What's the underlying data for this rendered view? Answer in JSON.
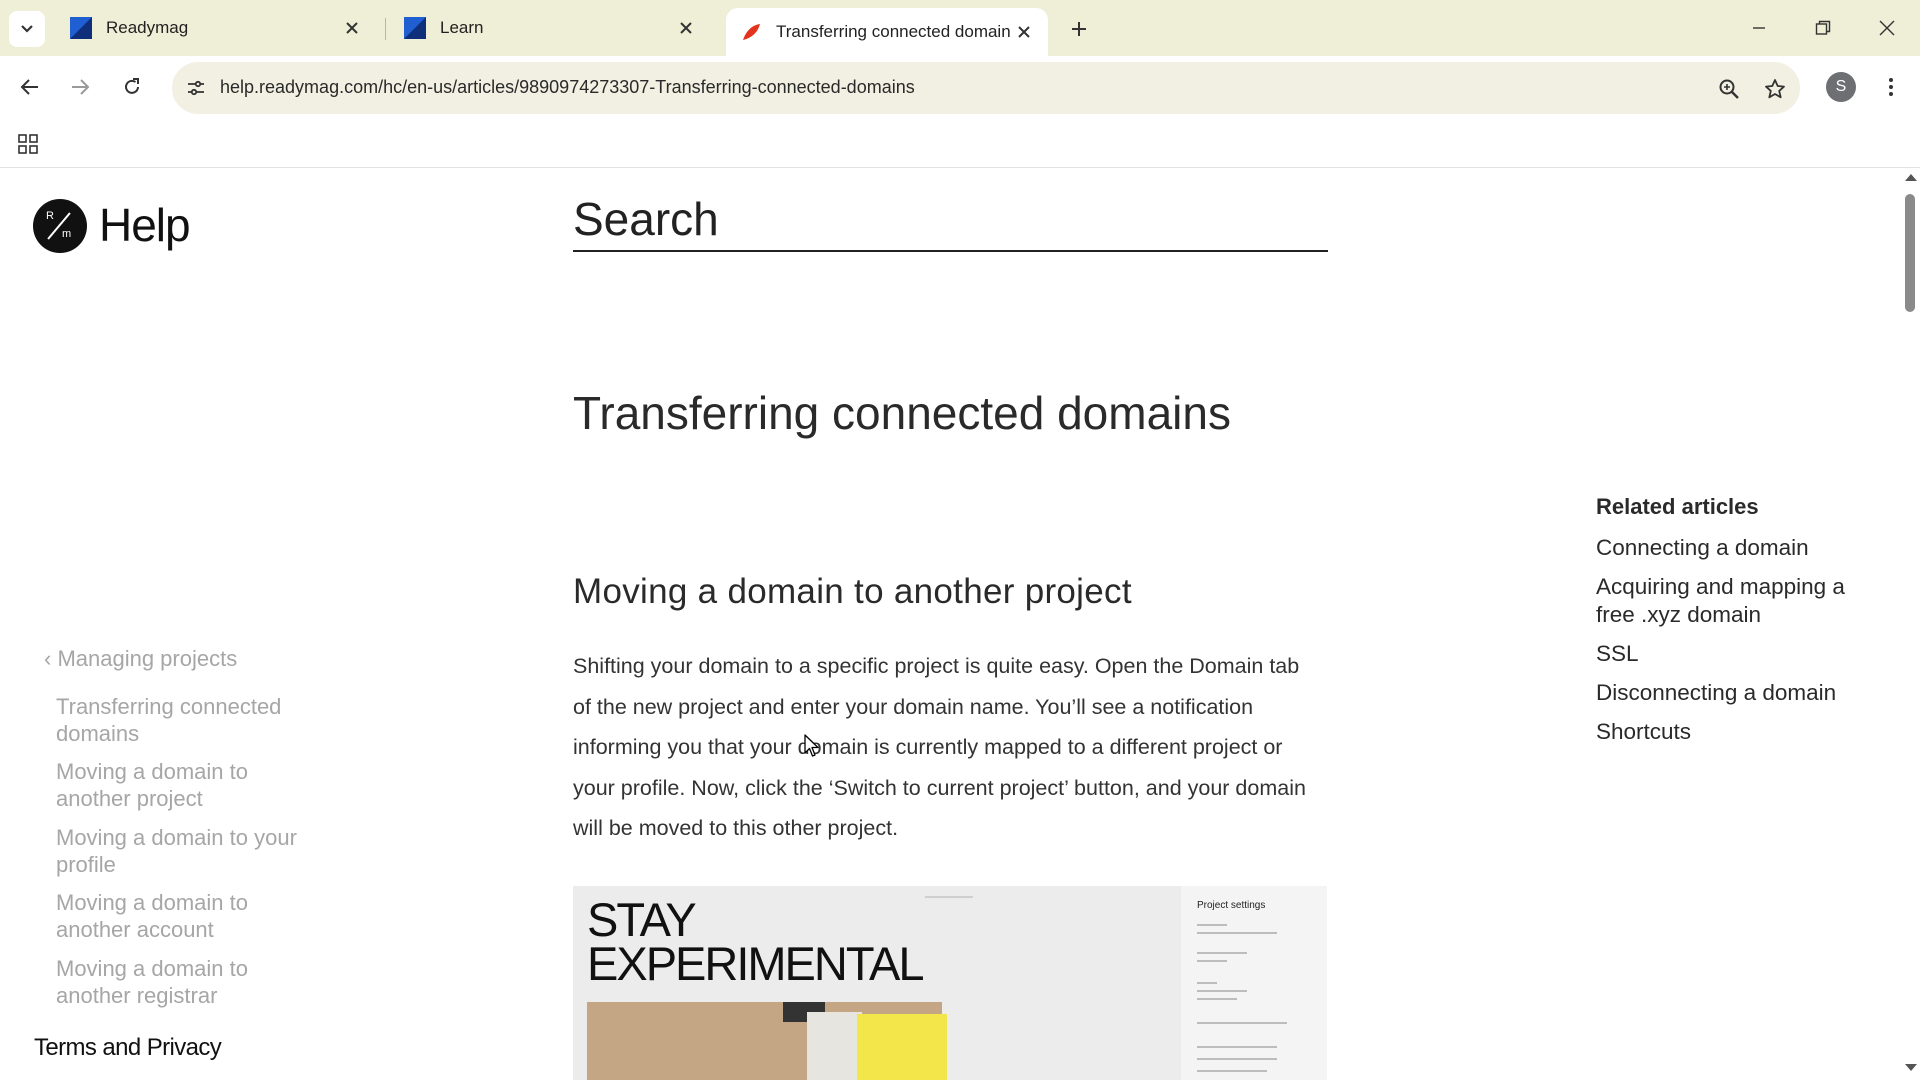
{
  "browser": {
    "tabs": [
      {
        "title": "Readymag",
        "icon": "readymag-favicon",
        "active": false
      },
      {
        "title": "Learn",
        "icon": "readymag-favicon",
        "active": false
      },
      {
        "title": "Transferring connected domain",
        "icon": "help-favicon",
        "active": true
      }
    ],
    "url": "help.readymag.com/hc/en-us/articles/9890974273307-Transferring-connected-domains",
    "profile_initial": "S"
  },
  "header": {
    "logo_r": "R",
    "logo_m": "m",
    "help_title": "Help",
    "search_placeholder": "Search"
  },
  "article": {
    "title": "Transferring connected domains",
    "section_title": "Moving a domain to another project",
    "body": "Shifting your domain to a specific project is quite easy. Open the Domain tab of the new project and enter your domain name. You’ll see a notification informing you that your domain is currently mapped to a different project or your profile. Now, click the ‘Switch to current project’ button, and your domain will be moved to this other project.",
    "image": {
      "headline_line1": "STAY",
      "headline_line2": "EXPERIMENTAL",
      "panel_title": "Project settings"
    }
  },
  "left_nav": {
    "back_label": "‹ Managing projects",
    "items": [
      "Transferring connected domains",
      "Moving a domain to another project",
      "Moving a domain to your profile",
      "Moving a domain to another account",
      "Moving a domain to another registrar"
    ],
    "footer": "Terms and Privacy"
  },
  "related": {
    "title": "Related articles",
    "items": [
      "Connecting a domain",
      "Acquiring and mapping a free .xyz domain",
      "SSL",
      "Disconnecting a domain",
      "Shortcuts"
    ]
  },
  "colors": {
    "tabbar_bg": "#efeed7",
    "omnibox_bg": "#f1f0e2",
    "muted_text": "#a6a6a6",
    "heading_text": "#2a2a2a"
  }
}
